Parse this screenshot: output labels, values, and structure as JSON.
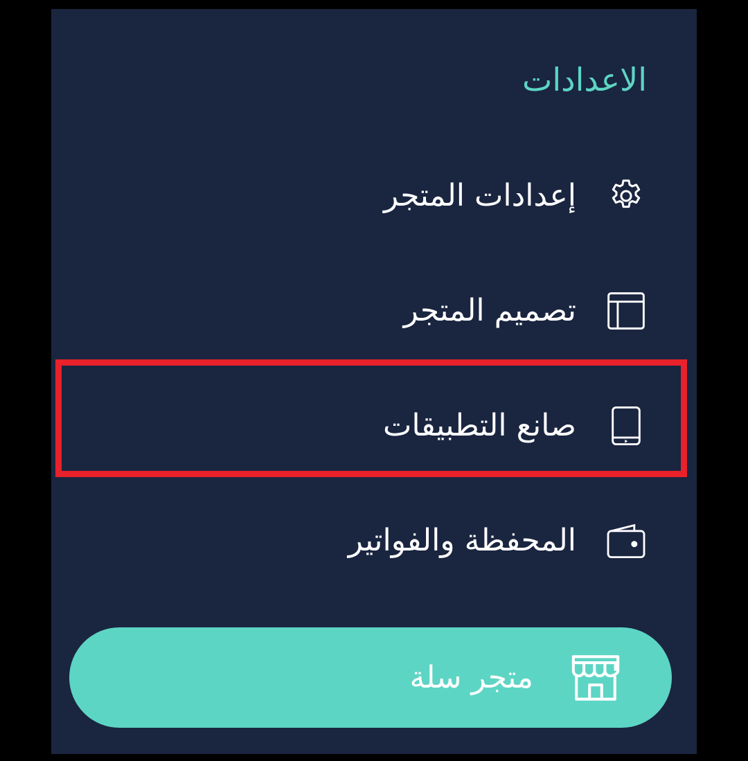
{
  "sidebar": {
    "section_title": "الاعدادات",
    "items": [
      {
        "label": "إعدادات المتجر",
        "icon": "gear-icon"
      },
      {
        "label": "تصميم المتجر",
        "icon": "layout-icon"
      },
      {
        "label": "صانع التطبيقات",
        "icon": "mobile-app-icon",
        "highlighted": true
      },
      {
        "label": "المحفظة والفواتير",
        "icon": "wallet-icon"
      }
    ],
    "store_button": {
      "label": "متجر سلة",
      "icon": "storefront-icon"
    }
  },
  "colors": {
    "panel_background": "#1a2540",
    "accent": "#5dd5c4",
    "highlight_border": "#e8212a",
    "text": "#ffffff"
  }
}
